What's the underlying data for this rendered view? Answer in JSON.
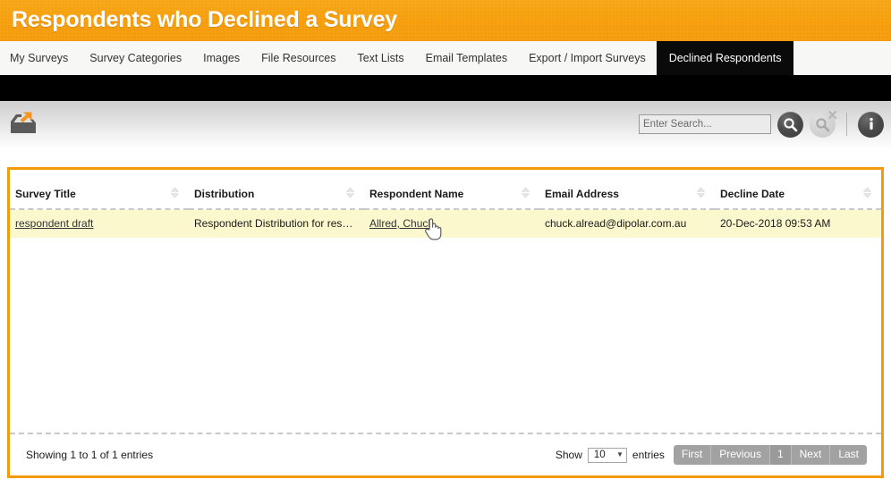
{
  "header": {
    "title": "Respondents who Declined a Survey",
    "accent_color": "#f59b0b",
    "text_color": "#ffffff"
  },
  "tabs": [
    {
      "label": "My Surveys",
      "active": false
    },
    {
      "label": "Survey Categories",
      "active": false
    },
    {
      "label": "Images",
      "active": false
    },
    {
      "label": "File Resources",
      "active": false
    },
    {
      "label": "Text Lists",
      "active": false
    },
    {
      "label": "Email Templates",
      "active": false
    },
    {
      "label": "Export / Import Surveys",
      "active": false
    },
    {
      "label": "Declined Respondents",
      "active": true
    }
  ],
  "toolbar": {
    "export_icon": "export-tray-icon",
    "search": {
      "value": "",
      "placeholder": "Enter Search..."
    },
    "search_button": "search-icon",
    "clear_search_button": "clear-search-icon",
    "info_button": "info-icon"
  },
  "table": {
    "columns": [
      {
        "label": "Survey Title",
        "sortable": true
      },
      {
        "label": "Distribution",
        "sortable": true
      },
      {
        "label": "Respondent Name",
        "sortable": true
      },
      {
        "label": "Email Address",
        "sortable": true
      },
      {
        "label": "Decline Date",
        "sortable": true
      }
    ],
    "rows": [
      {
        "survey_title": "respondent draft",
        "distribution": "Respondent Distribution for respo…",
        "respondent_name": "Allred, Chuck",
        "email_address": "chuck.alread@dipolar.com.au",
        "decline_date": "20-Dec-2018 09:53 AM"
      }
    ],
    "row_highlight_color": "#fbf8cd"
  },
  "footer": {
    "showing_text": "Showing 1 to 1 of 1 entries",
    "show_label": "Show",
    "entries_label": "entries",
    "page_length": "10",
    "pagination": [
      {
        "label": "First",
        "current": false
      },
      {
        "label": "Previous",
        "current": false
      },
      {
        "label": "1",
        "current": true
      },
      {
        "label": "Next",
        "current": false
      },
      {
        "label": "Last",
        "current": false
      }
    ]
  },
  "cursor": {
    "type": "pointer-hand"
  }
}
